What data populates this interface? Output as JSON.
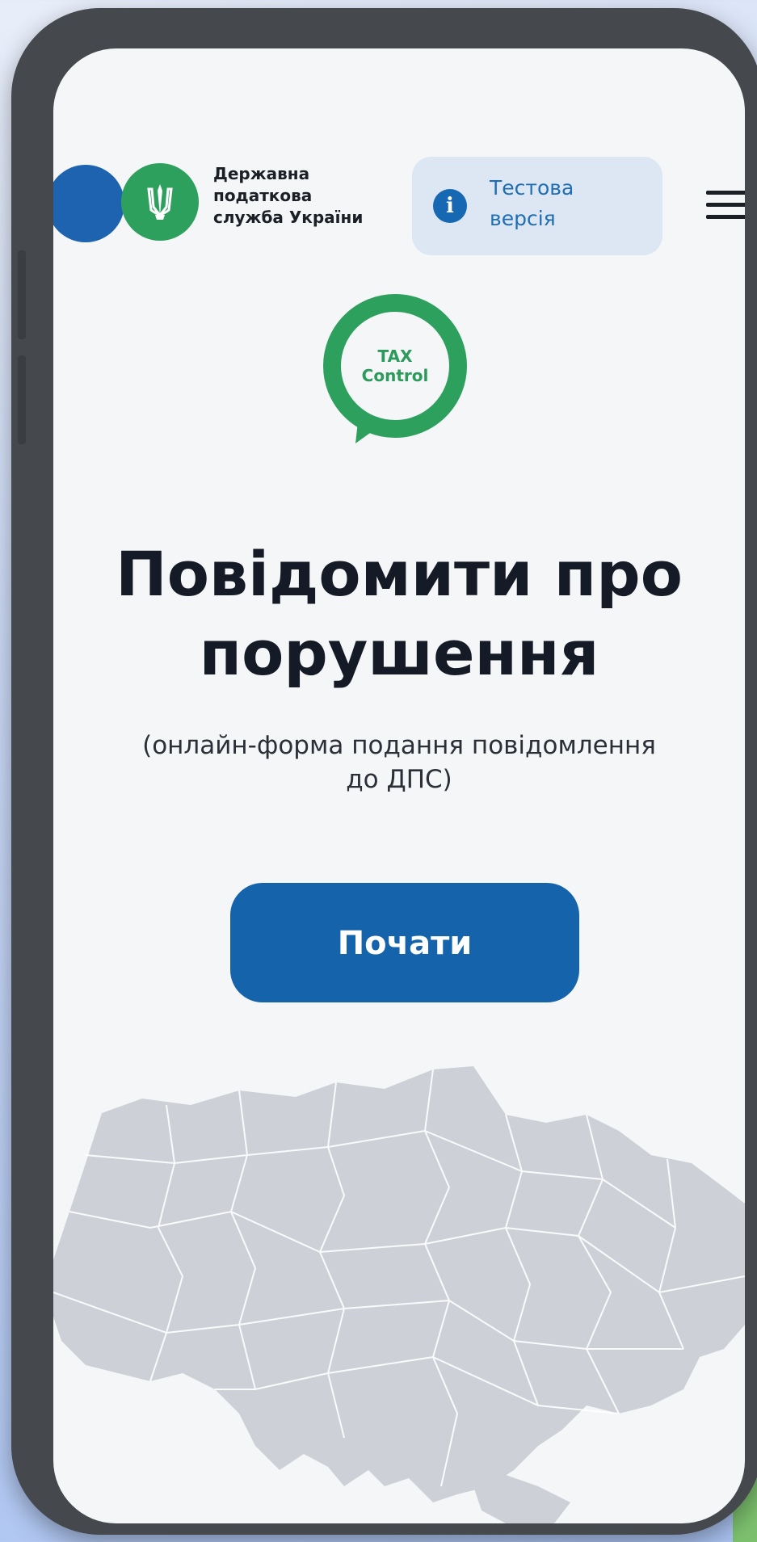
{
  "header": {
    "org_name_lines": [
      "Державна",
      "податкова",
      "служба України"
    ],
    "test_badge": {
      "icon": "info-icon",
      "lines": [
        "Тестова",
        "версія"
      ]
    },
    "menu_icon": "hamburger-menu-icon"
  },
  "logo": {
    "lines": [
      "TAX",
      "Control"
    ]
  },
  "main": {
    "title_lines": [
      "Повідомити про",
      "порушення"
    ],
    "subtitle_lines": [
      "(онлайн-форма подання повідомлення",
      "до ДПС)"
    ],
    "start_button_label": "Почати"
  },
  "colors": {
    "blue": "#1463ab",
    "green": "#2ea05e",
    "map_gray": "#cdd1d7"
  }
}
